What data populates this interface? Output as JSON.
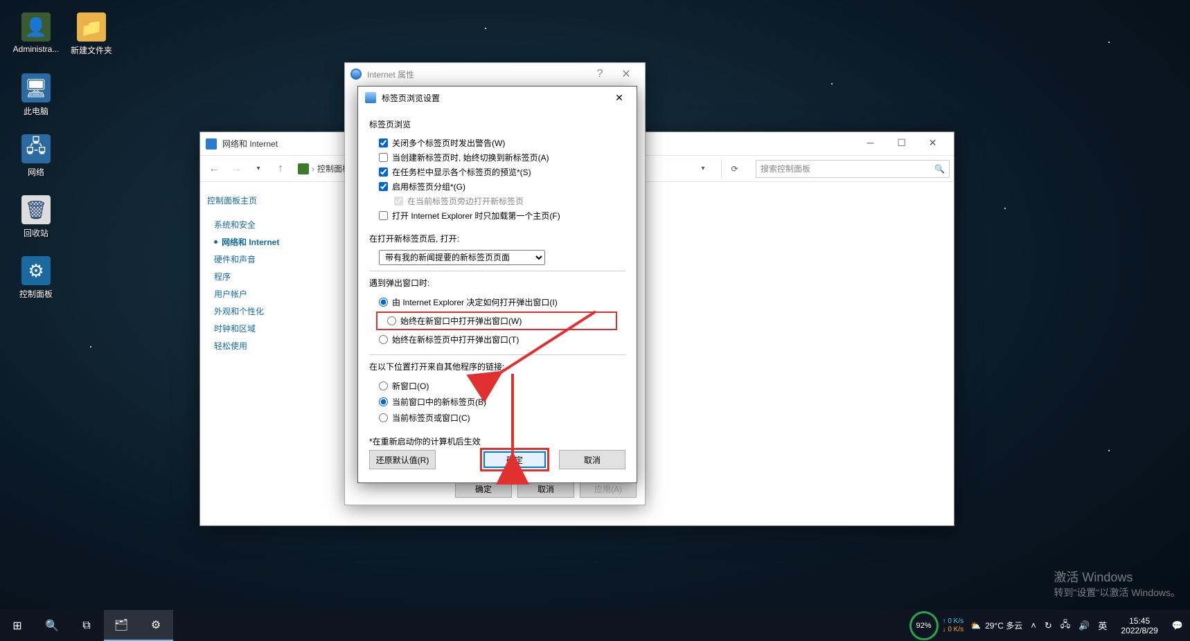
{
  "desktop": {
    "icons": [
      {
        "label": "Administra...",
        "glyph": "👤"
      },
      {
        "label": "新建文件夹",
        "glyph": "📁"
      },
      {
        "label": "此电脑",
        "glyph": "🖥"
      },
      {
        "label": "网络",
        "glyph": "🖧"
      },
      {
        "label": "回收站",
        "glyph": "🗑"
      },
      {
        "label": "控制面板",
        "glyph": "⚙"
      }
    ]
  },
  "cp": {
    "title": "网络和 Internet",
    "breadcrumb": [
      "控制面板"
    ],
    "searchPlaceholder": "搜索控制面板",
    "sideTitle": "控制面板主页",
    "sideItems": [
      "系统和安全",
      "网络和 Internet",
      "硬件和声音",
      "程序",
      "用户帐户",
      "外观和个性化",
      "时钟和区域",
      "轻松使用"
    ],
    "activeIndex": 1
  },
  "ip": {
    "title": "Internet 属性",
    "ok": "确定",
    "cancel": "取消",
    "apply": "应用(A)"
  },
  "ts": {
    "title": "标签页浏览设置",
    "section1": "标签页浏览",
    "chk1": "关闭多个标签页时发出警告(W)",
    "chk2": "当创建新标签页时, 始终切换到新标签页(A)",
    "chk3": "在任务栏中显示各个标签页的预览*(S)",
    "chk4": "启用标签页分组*(G)",
    "chk4a": "在当前标签页旁边打开新标签页",
    "chk5": "打开 Internet Explorer 时只加载第一个主页(F)",
    "section2": "在打开新标签页后, 打开:",
    "dropdown": "带有我的新闻提要的新标签页页面",
    "section3": "遇到弹出窗口时:",
    "r1": "由 Internet Explorer 决定如何打开弹出窗口(I)",
    "r2": "始终在新窗口中打开弹出窗口(W)",
    "r3": "始终在新标签页中打开弹出窗口(T)",
    "section4": "在以下位置打开来自其他程序的链接:",
    "r4": "新窗口(O)",
    "r5": "当前窗口中的新标签页(B)",
    "r6": "当前标签页或窗口(C)",
    "note": "*在重新启动你的计算机后生效",
    "restore": "还原默认值(R)",
    "ok": "确定",
    "cancel": "取消"
  },
  "taskbar": {
    "weather": "29°C 多云",
    "ime": "英",
    "time": "15:45",
    "date": "2022/8/29",
    "gauge": "92%",
    "netdown": "0 K/s",
    "netup": "0 K/s"
  },
  "watermark": {
    "line1": "激活 Windows",
    "line2": "转到\"设置\"以激活 Windows。"
  }
}
